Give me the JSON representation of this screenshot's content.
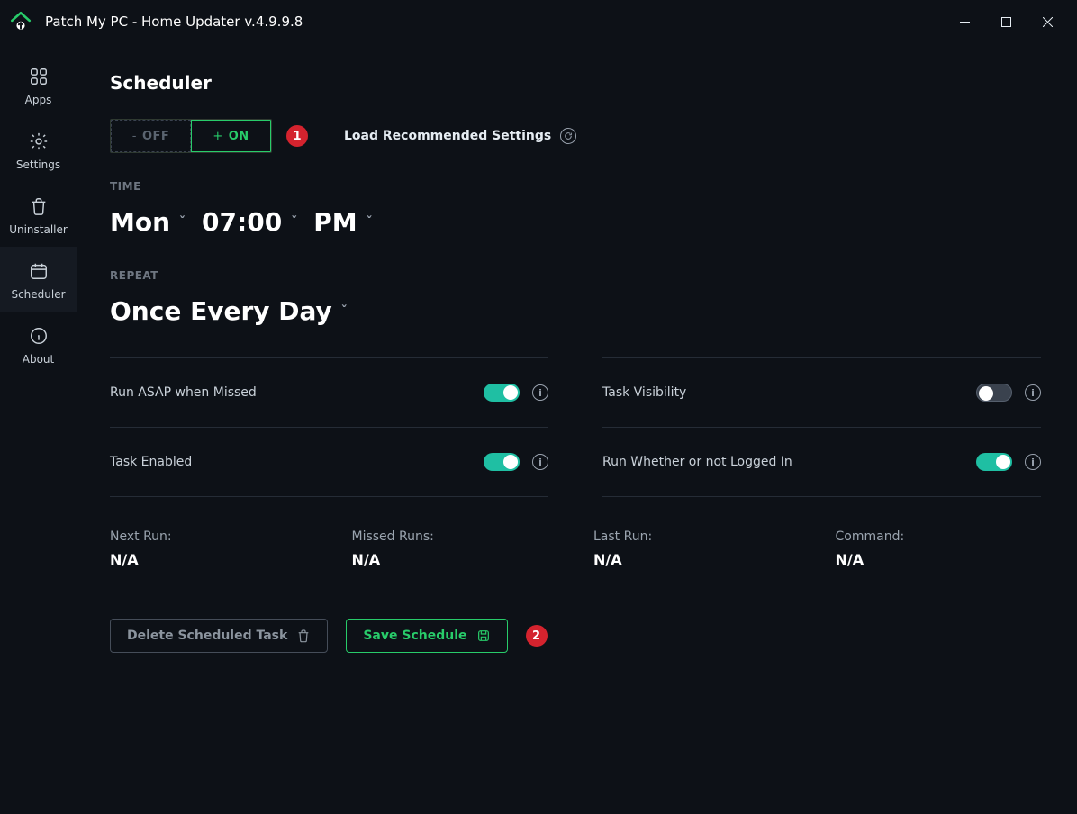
{
  "window": {
    "title": "Patch My PC - Home Updater v.4.9.9.8"
  },
  "sidebar": {
    "items": [
      {
        "label": "Apps"
      },
      {
        "label": "Settings"
      },
      {
        "label": "Uninstaller"
      },
      {
        "label": "Scheduler"
      },
      {
        "label": "About"
      }
    ]
  },
  "page": {
    "title": "Scheduler",
    "toggle": {
      "off": "OFF",
      "on": "ON"
    },
    "load_recommended": "Load Recommended Settings",
    "time_label": "TIME",
    "time": {
      "day": "Mon",
      "hhmm": "07:00",
      "ampm": "PM"
    },
    "repeat_label": "REPEAT",
    "repeat_value": "Once Every Day",
    "options": {
      "run_asap": {
        "label": "Run ASAP when Missed",
        "value": true
      },
      "visibility": {
        "label": "Task Visibility",
        "value": false
      },
      "enabled": {
        "label": "Task Enabled",
        "value": true
      },
      "logged_in": {
        "label": "Run Whether or not Logged In",
        "value": true
      }
    },
    "status": {
      "next_run": {
        "label": "Next Run:",
        "value": "N/A"
      },
      "missed_runs": {
        "label": "Missed Runs:",
        "value": "N/A"
      },
      "last_run": {
        "label": "Last Run:",
        "value": "N/A"
      },
      "command": {
        "label": "Command:",
        "value": "N/A"
      }
    },
    "buttons": {
      "delete": "Delete Scheduled Task",
      "save": "Save Schedule"
    },
    "annotations": {
      "one": "1",
      "two": "2"
    }
  }
}
